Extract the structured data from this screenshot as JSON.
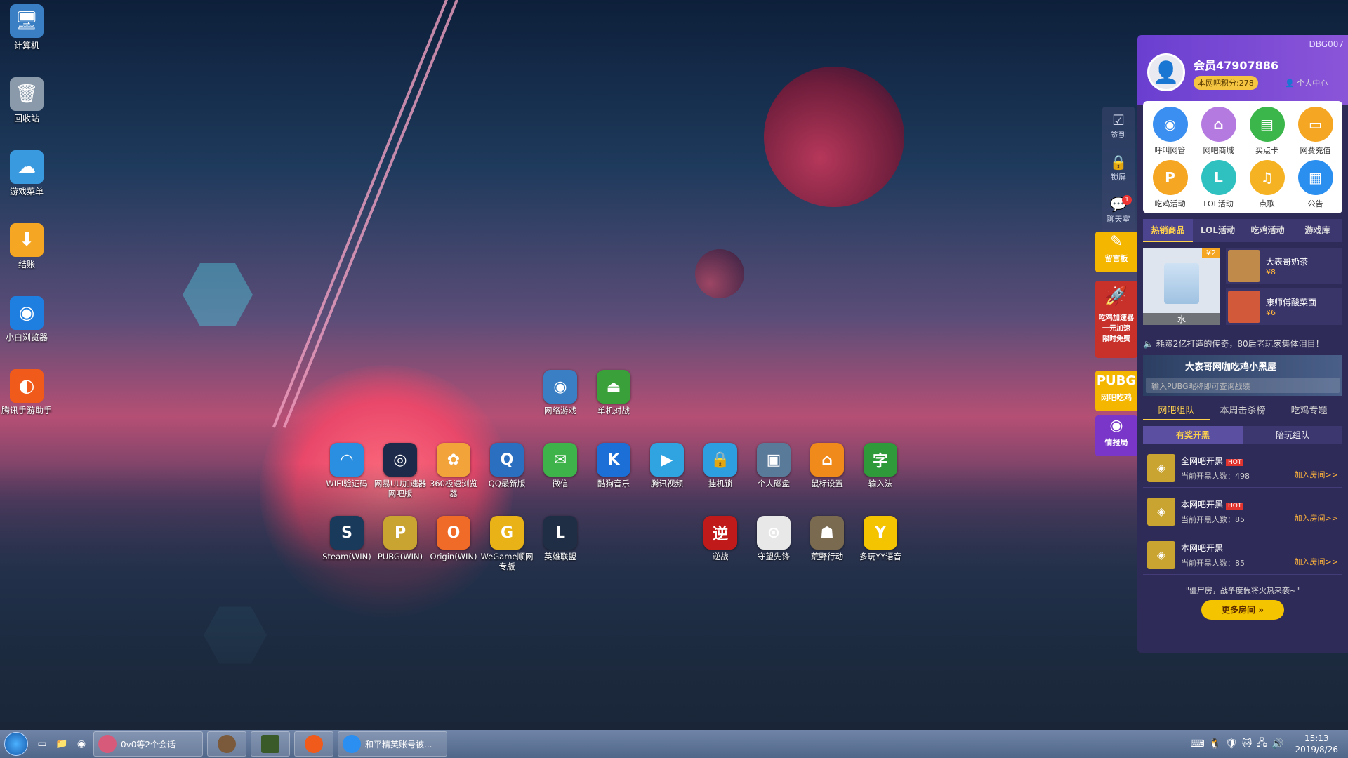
{
  "desktop_icons": [
    {
      "label": "计算机",
      "icon": "computer-icon"
    },
    {
      "label": "回收站",
      "icon": "recycle-bin-icon"
    },
    {
      "label": "游戏菜单",
      "icon": "cloud-game-icon"
    },
    {
      "label": "结账",
      "icon": "checkout-icon"
    },
    {
      "label": "小白浏览器",
      "icon": "browser-icon"
    },
    {
      "label": "腾讯手游助手",
      "icon": "tencent-mobile-icon"
    }
  ],
  "apps_row1": [
    {
      "label": "网络游戏",
      "color": "#3a7fc4",
      "glyph": "◉"
    },
    {
      "label": "单机对战",
      "color": "#3aa03a",
      "glyph": "⏏"
    }
  ],
  "apps_row2": [
    {
      "label": "WIFI验证码",
      "color": "#2a8fe0",
      "glyph": "◠"
    },
    {
      "label": "网易UU加速器网吧版",
      "color": "#1d2a4a",
      "glyph": "◎"
    },
    {
      "label": "360极速浏览器",
      "color": "#f2a33a",
      "glyph": "✿"
    },
    {
      "label": "QQ最新版",
      "color": "#2a6fc0",
      "glyph": "Q"
    },
    {
      "label": "微信",
      "color": "#3db34a",
      "glyph": "✉"
    },
    {
      "label": "酷狗音乐",
      "color": "#1b6fd6",
      "glyph": "K"
    },
    {
      "label": "腾讯视频",
      "color": "#2fa4e0",
      "glyph": "▶"
    },
    {
      "label": "挂机锁",
      "color": "#2d9ee0",
      "glyph": "🔒"
    },
    {
      "label": "个人磁盘",
      "color": "#5a7a9a",
      "glyph": "▣"
    },
    {
      "label": "鼠标设置",
      "color": "#f08a1a",
      "glyph": "⌂"
    },
    {
      "label": "输入法",
      "color": "#2e9a3a",
      "glyph": "字"
    }
  ],
  "apps_row3": [
    {
      "label": "Steam(WIN)",
      "color": "#1a3a5c",
      "glyph": "S"
    },
    {
      "label": "PUBG(WIN)",
      "color": "#c9a431",
      "glyph": "P"
    },
    {
      "label": "Origin(WIN)",
      "color": "#f06a28",
      "glyph": "O"
    },
    {
      "label": "WeGame顺网专版",
      "color": "#e9b318",
      "glyph": "G"
    },
    {
      "label": "英雄联盟",
      "color": "#1f2e45",
      "glyph": "L"
    }
  ],
  "apps_row3b": [
    {
      "label": "逆战",
      "color": "#c01a1a",
      "glyph": "逆"
    },
    {
      "label": "守望先锋",
      "color": "#e8e8e8",
      "glyph": "⊙"
    },
    {
      "label": "荒野行动",
      "color": "#7a6a50",
      "glyph": "☗"
    },
    {
      "label": "多玩YY语音",
      "color": "#f5c400",
      "glyph": "Y"
    }
  ],
  "dock": [
    {
      "label": "签到",
      "icon": "calendar-check-icon",
      "glyph": "☑"
    },
    {
      "label": "锁屏",
      "icon": "lock-icon",
      "glyph": "🔒"
    },
    {
      "label": "聊天室",
      "icon": "chat-icon",
      "glyph": "💬",
      "badge": "1"
    }
  ],
  "yellow_tiles": [
    {
      "label": "留言板"
    },
    {
      "label": "吃鸡加速器 一元加速 限时免费"
    },
    {
      "label": "网吧吃鸡"
    },
    {
      "label": "情报局"
    }
  ],
  "panel": {
    "id": "DBG007",
    "member": "会员47907886",
    "points": "本网吧积分:278",
    "personal_center": "个人中心",
    "grid": [
      {
        "label": "呼叫网管",
        "color": "#3a8ff0",
        "glyph": "◉"
      },
      {
        "label": "网吧商城",
        "color": "#b57ae0",
        "glyph": "⌂"
      },
      {
        "label": "买点卡",
        "color": "#3ab64a",
        "glyph": "▤"
      },
      {
        "label": "网费充值",
        "color": "#f5a623",
        "glyph": "▭"
      },
      {
        "label": "吃鸡活动",
        "color": "#f5a623",
        "glyph": "P"
      },
      {
        "label": "LOL活动",
        "color": "#2fc0c0",
        "glyph": "L"
      },
      {
        "label": "点歌",
        "color": "#f5b323",
        "glyph": "♫"
      },
      {
        "label": "公告",
        "color": "#2b8ff0",
        "glyph": "▦"
      }
    ],
    "tabs": [
      "热销商品",
      "LOL活动",
      "吃鸡活动",
      "游戏库"
    ],
    "goods": {
      "big": {
        "name": "水",
        "price": "¥2"
      },
      "list": [
        {
          "name": "大表哥奶茶",
          "price": "¥8"
        },
        {
          "name": "康师傅酸菜面",
          "price": "¥6"
        }
      ]
    },
    "notice": "耗资2亿打造的传奇，80后老玩家集体泪目！",
    "banner_title": "大表哥网咖吃鸡小黑屋",
    "banner_placeholder": "输入PUBG昵称即可查询战绩",
    "sub_tabs": [
      "网吧组队",
      "本周击杀榜",
      "吃鸡专题"
    ],
    "bar_a": "有奖开黑",
    "bar_b": "陪玩组队",
    "rooms": [
      {
        "title": "全网吧开黑",
        "hot": "HOT",
        "count": "当前开黑人数：498",
        "join": "加入房间>>"
      },
      {
        "title": "本网吧开黑",
        "hot": "HOT",
        "count": "当前开黑人数：85",
        "join": "加入房间>>"
      },
      {
        "title": "本网吧开黑",
        "hot": "",
        "count": "当前开黑人数：85",
        "join": "加入房间>>"
      }
    ],
    "footer": "\"僵尸房，战争度假将火热来袭~\"",
    "more": "更多房间 »"
  },
  "taskbar": {
    "tasks": [
      {
        "label": "0v0等2个会话",
        "color": "#d85a7a"
      },
      {
        "label": "和平精英账号被...",
        "color": "#2a8ff0"
      }
    ],
    "time": "15:13",
    "date": "2019/8/26"
  }
}
